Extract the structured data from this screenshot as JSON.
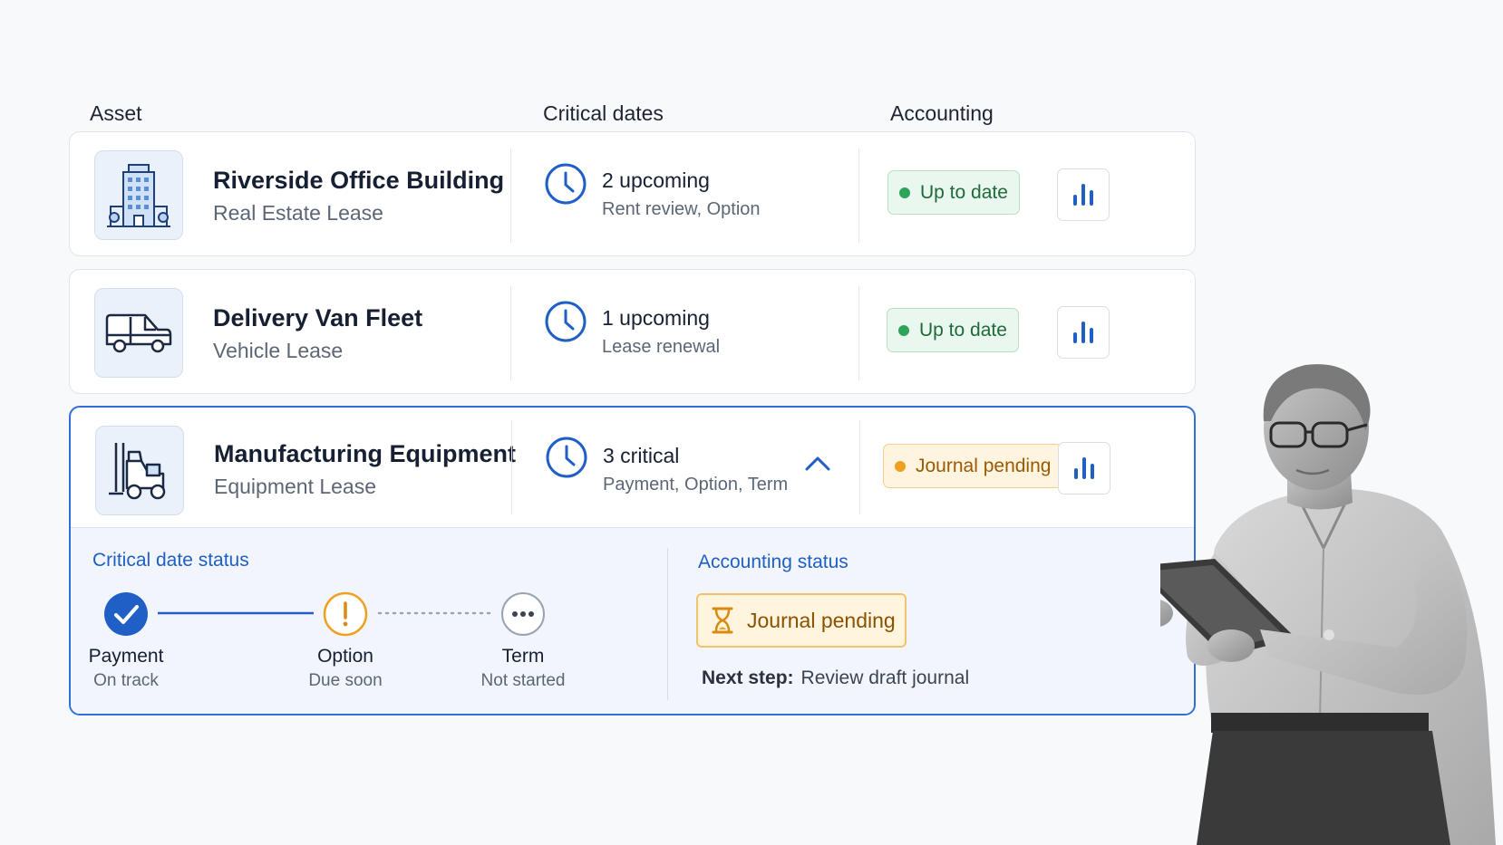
{
  "headers": {
    "asset": "Asset",
    "dates": "Critical dates",
    "accounting": "Accounting"
  },
  "rows": [
    {
      "name": "Riverside Office Building",
      "type": "Real Estate Lease",
      "dates_main": "2 upcoming",
      "dates_sub": "Rent review, Option",
      "status": "Up to date",
      "icon": "building-icon"
    },
    {
      "name": "Delivery Van Fleet",
      "type": "Vehicle Lease",
      "dates_main": "1 upcoming",
      "dates_sub": "Lease renewal",
      "status": "Up to date",
      "icon": "van-icon"
    },
    {
      "name": "Manufacturing Equipment",
      "type": "Equipment Lease",
      "dates_main": "3 critical",
      "dates_sub": "Payment, Option, Term",
      "status": "Journal pending",
      "icon": "forklift-icon"
    }
  ],
  "detail": {
    "critical_title": "Critical date status",
    "steps": [
      {
        "label": "Payment",
        "sub": "On track"
      },
      {
        "label": "Option",
        "sub": "Due soon"
      },
      {
        "label": "Term",
        "sub": "Not started"
      }
    ],
    "accounting_title": "Accounting status",
    "journal_status": "Journal pending",
    "next_step_label": "Next step:",
    "next_step_value": "Review draft journal"
  },
  "colors": {
    "accent": "#1f5fc6",
    "green": "#2ea45a",
    "amber": "#f0a020",
    "border": "#dfe3ea"
  }
}
